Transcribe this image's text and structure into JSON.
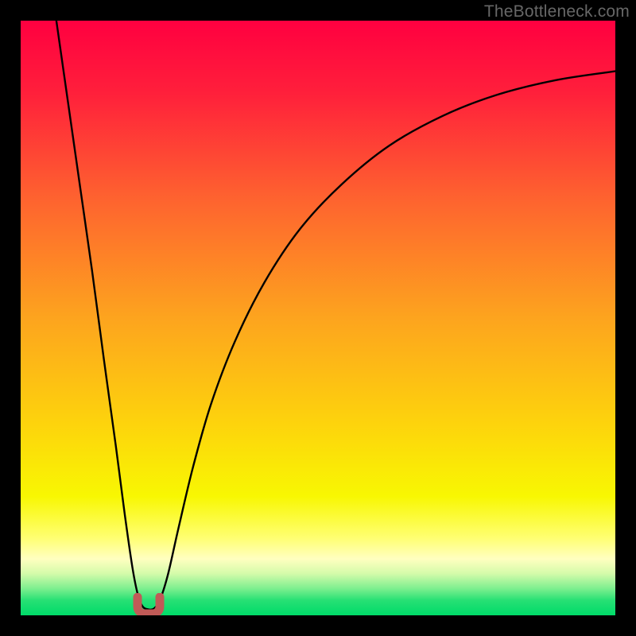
{
  "watermark": {
    "text": "TheBottleneck.com"
  },
  "chart_data": {
    "type": "line",
    "title": "",
    "xlabel": "",
    "ylabel": "",
    "xlim": [
      0,
      1
    ],
    "ylim": [
      0,
      1
    ],
    "legend": false,
    "grid": false,
    "background_gradient_stops": [
      {
        "offset": 0.0,
        "color": "#ff0040"
      },
      {
        "offset": 0.12,
        "color": "#ff1f3b"
      },
      {
        "offset": 0.3,
        "color": "#fe632f"
      },
      {
        "offset": 0.5,
        "color": "#fda41e"
      },
      {
        "offset": 0.68,
        "color": "#fdd40c"
      },
      {
        "offset": 0.8,
        "color": "#f8f702"
      },
      {
        "offset": 0.87,
        "color": "#ffff72"
      },
      {
        "offset": 0.905,
        "color": "#ffffc0"
      },
      {
        "offset": 0.93,
        "color": "#d4fbaa"
      },
      {
        "offset": 0.955,
        "color": "#7def8f"
      },
      {
        "offset": 0.975,
        "color": "#26e074"
      },
      {
        "offset": 1.0,
        "color": "#00db69"
      }
    ],
    "series": [
      {
        "name": "bottleneck-curve",
        "stroke": "#000000",
        "stroke_width": 2.4,
        "points": [
          {
            "x": 0.06,
            "y": 1.0
          },
          {
            "x": 0.08,
            "y": 0.86
          },
          {
            "x": 0.1,
            "y": 0.72
          },
          {
            "x": 0.12,
            "y": 0.58
          },
          {
            "x": 0.14,
            "y": 0.43
          },
          {
            "x": 0.16,
            "y": 0.285
          },
          {
            "x": 0.175,
            "y": 0.17
          },
          {
            "x": 0.188,
            "y": 0.08
          },
          {
            "x": 0.197,
            "y": 0.035
          },
          {
            "x": 0.205,
            "y": 0.015
          },
          {
            "x": 0.215,
            "y": 0.01
          },
          {
            "x": 0.225,
            "y": 0.012
          },
          {
            "x": 0.235,
            "y": 0.028
          },
          {
            "x": 0.248,
            "y": 0.07
          },
          {
            "x": 0.265,
            "y": 0.145
          },
          {
            "x": 0.29,
            "y": 0.25
          },
          {
            "x": 0.32,
            "y": 0.355
          },
          {
            "x": 0.36,
            "y": 0.46
          },
          {
            "x": 0.41,
            "y": 0.56
          },
          {
            "x": 0.47,
            "y": 0.65
          },
          {
            "x": 0.54,
            "y": 0.725
          },
          {
            "x": 0.62,
            "y": 0.79
          },
          {
            "x": 0.71,
            "y": 0.84
          },
          {
            "x": 0.8,
            "y": 0.875
          },
          {
            "x": 0.9,
            "y": 0.9
          },
          {
            "x": 1.0,
            "y": 0.915
          }
        ]
      }
    ],
    "minimum_marker": {
      "x": 0.215,
      "y": 0.018,
      "color": "#c05a57",
      "shape": "rounded-u"
    }
  }
}
